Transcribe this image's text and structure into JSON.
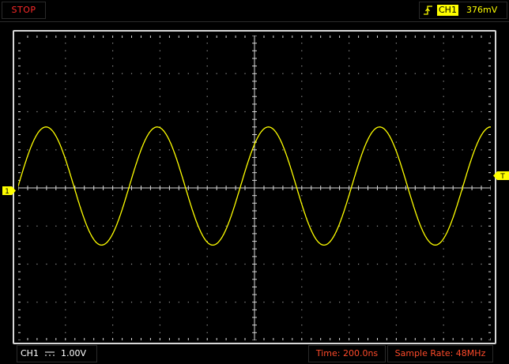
{
  "status": {
    "label": "STOP",
    "color": "#ff2a2a"
  },
  "trigger": {
    "edge_icon": "rising-edge-icon",
    "channel": "CH1",
    "level": "376mV"
  },
  "channel_marker": {
    "label": "1",
    "color": "#ffff00"
  },
  "trigger_marker": {
    "label": "T",
    "color": "#ffff00"
  },
  "bottom": {
    "channel_label": "CH1",
    "coupling_icon": "dc-coupling-icon",
    "channel_scale": "1.00V",
    "timebase": "Time: 200.0ns",
    "sample_rate": "Sample Rate: 48MHz"
  },
  "colors": {
    "trace": "#ffff00",
    "grid": "#9a9a9a",
    "readout": "#ff4a2a"
  },
  "chart_data": {
    "type": "line",
    "grid_divisions": {
      "x": 10,
      "y": 8
    },
    "series": [
      {
        "waveform": "sine",
        "cycles_on_screen": 4.25,
        "amplitude_div": 1.55,
        "offset_div": 0.05,
        "start_phase_deg": 0
      }
    ]
  }
}
